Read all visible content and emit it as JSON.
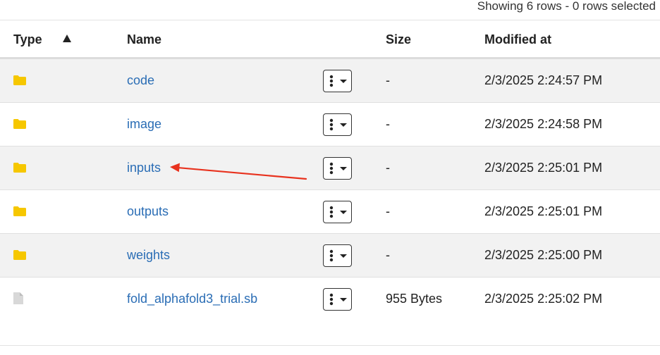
{
  "status": {
    "text": "Showing 6 rows - 0 rows selected"
  },
  "table": {
    "columns": {
      "type": "Type",
      "name": "Name",
      "size": "Size",
      "modified": "Modified at"
    },
    "sort": {
      "column": "Type",
      "direction": "ascending",
      "icon": "sort-ascending-icon"
    },
    "rows": [
      {
        "type": "folder",
        "icon": "folder-icon",
        "name": "code",
        "size": "-",
        "modified": "2/3/2025 2:24:57 PM"
      },
      {
        "type": "folder",
        "icon": "folder-icon",
        "name": "image",
        "size": "-",
        "modified": "2/3/2025 2:24:58 PM"
      },
      {
        "type": "folder",
        "icon": "folder-icon",
        "name": "inputs",
        "size": "-",
        "modified": "2/3/2025 2:25:01 PM"
      },
      {
        "type": "folder",
        "icon": "folder-icon",
        "name": "outputs",
        "size": "-",
        "modified": "2/3/2025 2:25:01 PM"
      },
      {
        "type": "folder",
        "icon": "folder-icon",
        "name": "weights",
        "size": "-",
        "modified": "2/3/2025 2:25:00 PM"
      },
      {
        "type": "file",
        "icon": "file-icon",
        "name": "fold_alphafold3_trial.sb",
        "size": "955 Bytes",
        "modified": "2/3/2025 2:25:02 PM"
      }
    ]
  },
  "colors": {
    "folder": "#f6c700",
    "file": "#d8d8d8",
    "link": "#2a6db5",
    "annotation_arrow": "#e8321e"
  }
}
